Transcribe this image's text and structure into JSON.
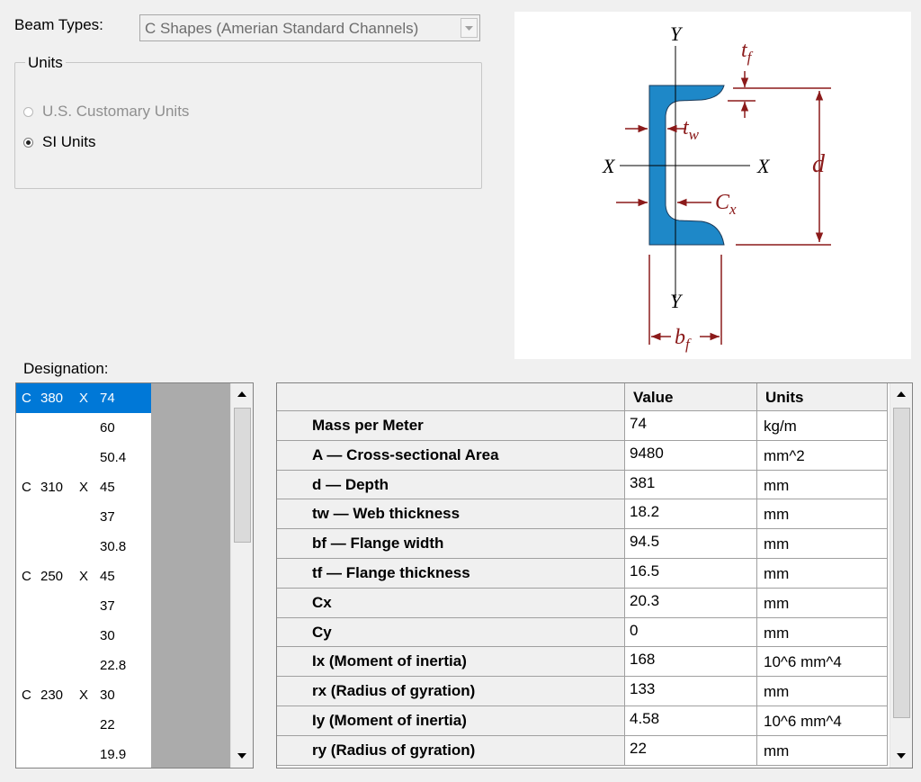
{
  "beam": {
    "label": "Beam Types:",
    "selected": "C Shapes (Amerian Standard Channels)"
  },
  "units": {
    "legend": "Units",
    "options": [
      {
        "label": "U.S. Customary Units",
        "checked": false,
        "enabled": false
      },
      {
        "label": "SI Units",
        "checked": true,
        "enabled": true
      }
    ]
  },
  "diagram": {
    "labels": {
      "y_top": "Y",
      "y_bottom": "Y",
      "x_left": "X",
      "x_right": "X",
      "d": "d",
      "tf_base": "t",
      "tf_sub": "f",
      "tw_base": "t",
      "tw_sub": "w",
      "cx_base": "C",
      "cx_sub": "x",
      "bf_base": "b",
      "bf_sub": "f"
    },
    "colors": {
      "fill": "#1e88c8",
      "dimension": "#8b1a1a",
      "axis": "#000000"
    }
  },
  "designation": {
    "label": "Designation:",
    "rows": [
      {
        "prefix": "C",
        "depth": "380",
        "x": "X",
        "weight": "74",
        "selected": true
      },
      {
        "prefix": "",
        "depth": "",
        "x": "",
        "weight": "60",
        "selected": false
      },
      {
        "prefix": "",
        "depth": "",
        "x": "",
        "weight": "50.4",
        "selected": false
      },
      {
        "prefix": "C",
        "depth": "310",
        "x": "X",
        "weight": "45",
        "selected": false
      },
      {
        "prefix": "",
        "depth": "",
        "x": "",
        "weight": "37",
        "selected": false
      },
      {
        "prefix": "",
        "depth": "",
        "x": "",
        "weight": "30.8",
        "selected": false
      },
      {
        "prefix": "C",
        "depth": "250",
        "x": "X",
        "weight": "45",
        "selected": false
      },
      {
        "prefix": "",
        "depth": "",
        "x": "",
        "weight": "37",
        "selected": false
      },
      {
        "prefix": "",
        "depth": "",
        "x": "",
        "weight": "30",
        "selected": false
      },
      {
        "prefix": "",
        "depth": "",
        "x": "",
        "weight": "22.8",
        "selected": false
      },
      {
        "prefix": "C",
        "depth": "230",
        "x": "X",
        "weight": "30",
        "selected": false
      },
      {
        "prefix": "",
        "depth": "",
        "x": "",
        "weight": "22",
        "selected": false
      },
      {
        "prefix": "",
        "depth": "",
        "x": "",
        "weight": "19.9",
        "selected": false
      }
    ]
  },
  "properties": {
    "headers": {
      "name": "",
      "value": "Value",
      "units": "Units"
    },
    "rows": [
      {
        "name": "Mass per Meter",
        "value": "74",
        "units": "kg/m"
      },
      {
        "name": "A — Cross-sectional Area",
        "value": "9480",
        "units": "mm^2"
      },
      {
        "name": "d — Depth",
        "value": "381",
        "units": "mm"
      },
      {
        "name": "tw — Web thickness",
        "value": "18.2",
        "units": "mm"
      },
      {
        "name": "bf — Flange width",
        "value": "94.5",
        "units": "mm"
      },
      {
        "name": "tf — Flange thickness",
        "value": "16.5",
        "units": "mm"
      },
      {
        "name": "Cx",
        "value": "20.3",
        "units": "mm"
      },
      {
        "name": "Cy",
        "value": "0",
        "units": "mm"
      },
      {
        "name": "Ix (Moment of inertia)",
        "value": "168",
        "units": "10^6  mm^4"
      },
      {
        "name": "rx (Radius of gyration)",
        "value": "133",
        "units": "mm"
      },
      {
        "name": "Iy (Moment of inertia)",
        "value": "4.58",
        "units": "10^6  mm^4"
      },
      {
        "name": "ry (Radius of gyration)",
        "value": "22",
        "units": "mm"
      }
    ]
  }
}
